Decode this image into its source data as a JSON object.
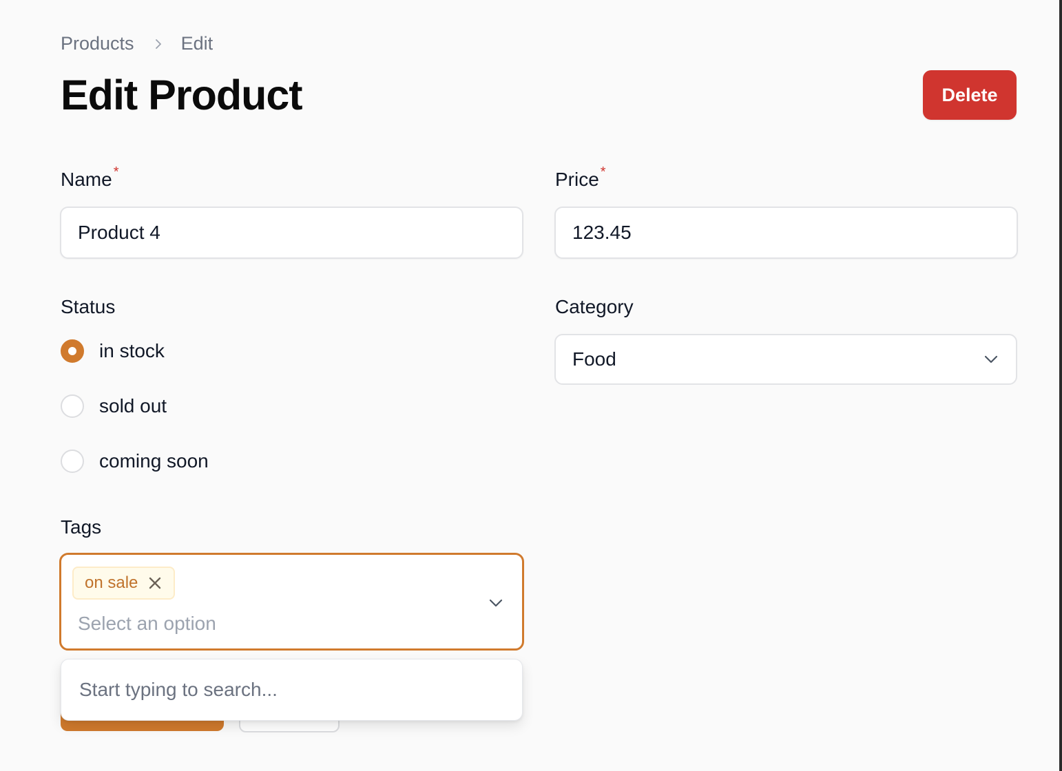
{
  "breadcrumb": {
    "items": [
      "Products",
      "Edit"
    ]
  },
  "page": {
    "title": "Edit Product",
    "delete_label": "Delete"
  },
  "form": {
    "name": {
      "label": "Name",
      "required_mark": "*",
      "value": "Product 4"
    },
    "price": {
      "label": "Price",
      "required_mark": "*",
      "value": "123.45"
    },
    "status": {
      "label": "Status",
      "options": [
        "in stock",
        "sold out",
        "coming soon"
      ],
      "selected": "in stock"
    },
    "category": {
      "label": "Category",
      "value": "Food"
    },
    "tags": {
      "label": "Tags",
      "selected": [
        "on sale"
      ],
      "placeholder": "Select an option",
      "search_placeholder": "Start typing to search..."
    }
  },
  "colors": {
    "accent": "#d07a2d",
    "danger": "#d0352f",
    "tag_bg": "#fffbeb",
    "tag_text": "#c0732c"
  },
  "icons": {
    "breadcrumb_separator": "chevron-right-icon",
    "select_chevron": "chevron-down-icon",
    "tag_remove": "close-icon"
  }
}
